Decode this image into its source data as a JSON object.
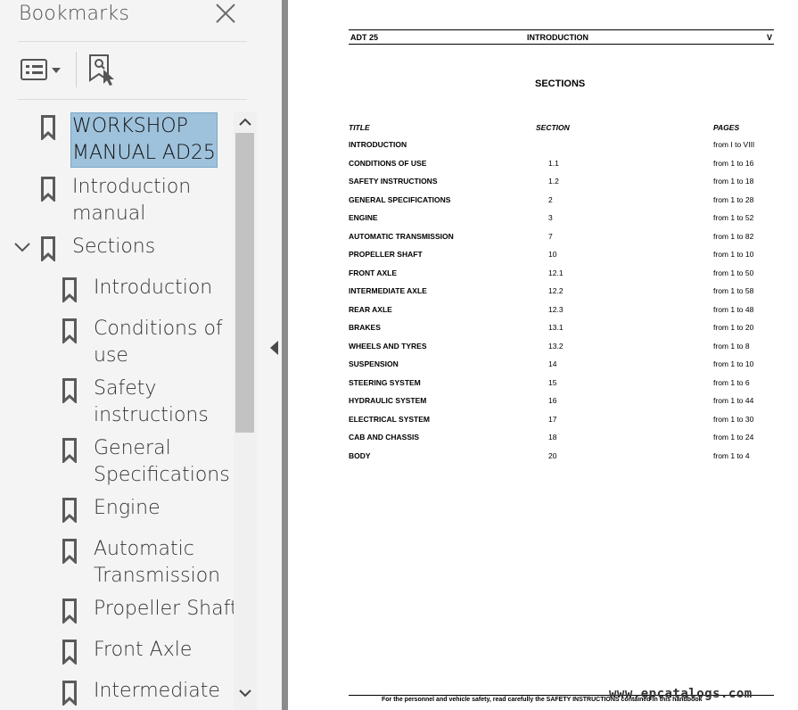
{
  "panel": {
    "title": "Bookmarks",
    "bookmarks": [
      {
        "label": "WORKSHOP\nMANUAL AD25"
      },
      {
        "label": "Introduction\nmanual"
      },
      {
        "label": "Sections"
      },
      {
        "label": "Introduction"
      },
      {
        "label": "Conditions of\nuse"
      },
      {
        "label": "Safety\ninstructions"
      },
      {
        "label": "General\nSpecifications"
      },
      {
        "label": "Engine"
      },
      {
        "label": "Automatic\nTransmission"
      },
      {
        "label": "Propeller Shaft"
      },
      {
        "label": "Front Axle"
      },
      {
        "label": "Intermediate"
      }
    ]
  },
  "doc": {
    "header_left": "ADT 25",
    "header_center": "INTRODUCTION",
    "header_right": "V",
    "section_title": "SECTIONS",
    "col_title": "TITLE",
    "col_section": "SECTION",
    "col_pages": "PAGES",
    "rows": [
      {
        "title": "INTRODUCTION",
        "section": "",
        "pages": "from I to VIII"
      },
      {
        "title": "CONDITIONS OF USE",
        "section": "1.1",
        "pages": "from 1 to 16"
      },
      {
        "title": "SAFETY INSTRUCTIONS",
        "section": "1.2",
        "pages": "from 1 to 18"
      },
      {
        "title": "GENERAL SPECIFICATIONS",
        "section": "2",
        "pages": "from 1 to 28"
      },
      {
        "title": "ENGINE",
        "section": "3",
        "pages": "from 1 to 52"
      },
      {
        "title": "AUTOMATIC TRANSMISSION",
        "section": "7",
        "pages": "from 1 to 82"
      },
      {
        "title": "PROPELLER SHAFT",
        "section": "10",
        "pages": "from 1 to 10"
      },
      {
        "title": "FRONT AXLE",
        "section": "12.1",
        "pages": "from 1 to 50"
      },
      {
        "title": "INTERMEDIATE AXLE",
        "section": "12.2",
        "pages": "from 1 to 58"
      },
      {
        "title": "REAR AXLE",
        "section": "12.3",
        "pages": "from 1 to 48"
      },
      {
        "title": "BRAKES",
        "section": "13.1",
        "pages": "from 1 to 20"
      },
      {
        "title": "WHEELS AND TYRES",
        "section": "13.2",
        "pages": "from 1 to 8"
      },
      {
        "title": "SUSPENSION",
        "section": "14",
        "pages": "from 1 to 10"
      },
      {
        "title": "STEERING SYSTEM",
        "section": "15",
        "pages": "from 1 to 6"
      },
      {
        "title": "HYDRAULIC SYSTEM",
        "section": "16",
        "pages": "from 1 to 44"
      },
      {
        "title": "ELECTRICAL SYSTEM",
        "section": "17",
        "pages": "from 1 to 30"
      },
      {
        "title": "CAB AND CHASSIS",
        "section": "18",
        "pages": "from 1 to 24"
      },
      {
        "title": "BODY",
        "section": "20",
        "pages": "from 1 to 4"
      }
    ],
    "footer": "For the personnel and vehicle safety, read carefully the SAFETY INSTRUCTIONS contained in this handbook",
    "watermark": "www.epcatalogs.com"
  },
  "colors": {
    "selection": "#9fc2dc",
    "icon": "#5a5a5a"
  },
  "icons": {
    "close": "close-icon",
    "options": "list-options-icon",
    "find": "find-bookmark-icon",
    "bookmark": "bookmark-icon",
    "twisty": "chevron-down-icon"
  }
}
